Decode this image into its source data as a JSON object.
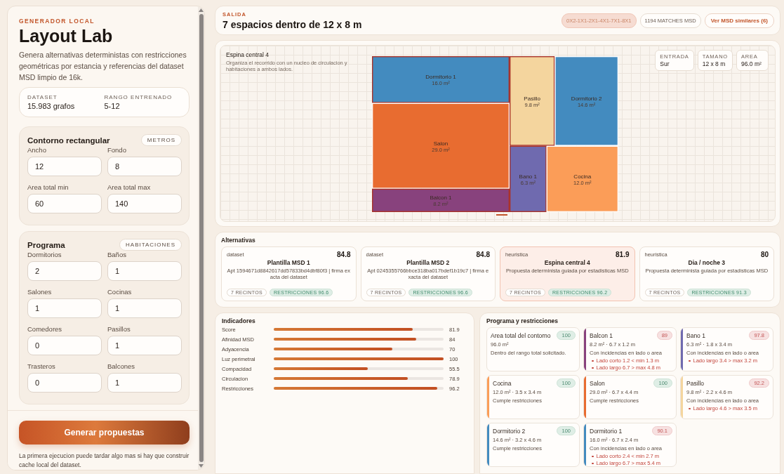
{
  "sidebar": {
    "kicker": "GENERADOR LOCAL",
    "title": "Layout Lab",
    "description": "Genera alternativas deterministas con restricciones geométricas por estancia y referencias del dataset MSD limpio de 16k.",
    "stats": [
      {
        "label": "DATASET",
        "value": "15.983 grafos"
      },
      {
        "label": "RANGO ENTRENADO",
        "value": "5-12"
      }
    ],
    "sections": [
      {
        "title": "Contorno rectangular",
        "tag": "METROS",
        "fields": [
          {
            "label": "Ancho",
            "value": "12"
          },
          {
            "label": "Fondo",
            "value": "8"
          },
          {
            "label": "Area total min",
            "value": "60"
          },
          {
            "label": "Area total max",
            "value": "140"
          }
        ]
      },
      {
        "title": "Programa",
        "tag": "HABITACIONES",
        "fields": [
          {
            "label": "Dormitorios",
            "value": "2"
          },
          {
            "label": "Baños",
            "value": "1"
          },
          {
            "label": "Salones",
            "value": "1"
          },
          {
            "label": "Cocinas",
            "value": "1"
          },
          {
            "label": "Comedores",
            "value": "0"
          },
          {
            "label": "Pasillos",
            "value": "1"
          },
          {
            "label": "Trasteros",
            "value": "0"
          },
          {
            "label": "Balcones",
            "value": "1"
          }
        ]
      }
    ],
    "button": "Generar propuestas",
    "note": "La primera ejecucion puede tardar algo mas si hay que construir cache local del dataset."
  },
  "output": {
    "kicker": "SALIDA",
    "title": "7 espacios dentro de 12 x 8 m",
    "signature": "0X2-1X1-2X1-4X1-7X1-8X1",
    "matches": "1194 MATCHES MSD",
    "link": "Ver MSD similares (6)"
  },
  "plan": {
    "title": "Espina central 4",
    "subtitle": "Organiza el recorrido con un nucleo de circulacion y habitaciones a ambos lados.",
    "chips": [
      {
        "label": "ENTRADA",
        "value": "Sur"
      },
      {
        "label": "TAMANO",
        "value": "12 x 8 m"
      },
      {
        "label": "AREA",
        "value": "96.0 m²"
      }
    ],
    "rooms": [
      {
        "name": "Dormitorio 1",
        "area": "16.0 m²",
        "color": "#438bbf",
        "issue": true
      },
      {
        "name": "Salon",
        "area": "29.0 m²",
        "color": "#e86c30",
        "issue": false
      },
      {
        "name": "Balcon 1",
        "area": "8.2 m²",
        "color": "#88427d",
        "issue": true
      },
      {
        "name": "Pasillo",
        "area": "9.8 m²",
        "color": "#f4d59e",
        "issue": true
      },
      {
        "name": "Dormitorio 2",
        "area": "14.6 m²",
        "color": "#438bbf",
        "issue": false
      },
      {
        "name": "Bano 1",
        "area": "6.3 m²",
        "color": "#6f6aaf",
        "issue": true
      },
      {
        "name": "Cocina",
        "area": "12.0 m²",
        "color": "#fb9d58",
        "issue": false
      }
    ]
  },
  "alternatives": {
    "title": "Alternativas",
    "items": [
      {
        "source": "dataset",
        "score": "84.8",
        "name": "Plantilla MSD 1",
        "description": "Apt 1594671d8842617dd57833bd4dbf80f3 | firma exacta del dataset",
        "rooms": "7 RECINTOS",
        "restrictions": "RESTRICCIONES 96.6",
        "selected": false
      },
      {
        "source": "dataset",
        "score": "84.8",
        "name": "Plantilla MSD 2",
        "description": "Apt 0245355766bbce318ba017bdef1b19c7 | firma exacta del dataset",
        "rooms": "7 RECINTOS",
        "restrictions": "RESTRICCIONES 96.6",
        "selected": false
      },
      {
        "source": "heuristica",
        "score": "81.9",
        "name": "Espina central 4",
        "description": "Propuesta determinista guiada por estadisticas MSD",
        "rooms": "7 RECINTOS",
        "restrictions": "RESTRICCIONES 96.2",
        "selected": true
      },
      {
        "source": "heuristica",
        "score": "80",
        "name": "Dia / noche 3",
        "description": "Propuesta determinista guiada por estadisticas MSD",
        "rooms": "7 RECINTOS",
        "restrictions": "RESTRICCIONES 91.3",
        "selected": false
      }
    ]
  },
  "indicators": {
    "title": "Indicadores",
    "items": [
      {
        "label": "Score",
        "level": 0.819,
        "value": "81.9"
      },
      {
        "label": "Afinidad MSD",
        "level": 0.84,
        "value": "84"
      },
      {
        "label": "Adyacencia",
        "level": 0.7,
        "value": "70"
      },
      {
        "label": "Luz perimetral",
        "level": 1,
        "value": "100"
      },
      {
        "label": "Compacidad",
        "level": 0.555,
        "value": "55.5"
      },
      {
        "label": "Circulacion",
        "level": 0.789,
        "value": "78.9"
      },
      {
        "label": "Restricciones",
        "level": 0.962,
        "value": "96.2"
      }
    ]
  },
  "constraints": {
    "title": "Programa y restricciones",
    "items": [
      {
        "name": "Area total del contorno",
        "score": "100",
        "ok": true,
        "detail": "96.0 m²",
        "status": "Dentro del rango total solicitado."
      },
      {
        "name": "Balcon 1",
        "score": "89",
        "ok": false,
        "color": "#88427d",
        "detail": "8.2 m² · 6.7 x 1.2 m",
        "status": "Con incidencias en lado o area",
        "issues": [
          "Lado corto 1.2 < min 1.3 m",
          "Lado largo 6.7 > max 4.8 m"
        ]
      },
      {
        "name": "Bano 1",
        "score": "97.8",
        "ok": false,
        "color": "#6f6aaf",
        "detail": "6.3 m² · 1.8 x 3.4 m",
        "status": "Con incidencias en lado o area",
        "issues": [
          "Lado largo 3.4 > max 3.2 m"
        ]
      },
      {
        "name": "Cocina",
        "score": "100",
        "ok": true,
        "color": "#fb9d58",
        "detail": "12.0 m² · 3.5 x 3.4 m",
        "status": "Cumple restricciones"
      },
      {
        "name": "Salon",
        "score": "100",
        "ok": true,
        "color": "#e86c30",
        "detail": "29.0 m² · 6.7 x 4.4 m",
        "status": "Cumple restricciones"
      },
      {
        "name": "Pasillo",
        "score": "92.2",
        "ok": false,
        "color": "#f4d59e",
        "detail": "9.8 m² · 2.2 x 4.6 m",
        "status": "Con incidencias en lado o area",
        "issues": [
          "Lado largo 4.6 > max 3.5 m"
        ]
      },
      {
        "name": "Dormitorio 2",
        "score": "100",
        "ok": true,
        "color": "#438bbf",
        "detail": "14.6 m² · 3.2 x 4.6 m",
        "status": "Cumple restricciones"
      },
      {
        "name": "Dormitorio 1",
        "score": "90.1",
        "ok": false,
        "color": "#438bbf",
        "detail": "16.0 m² · 6.7 x 2.4 m",
        "status": "Con incidencias en lado o area",
        "issues": [
          "Lado corto 2.4 < min 2.7 m",
          "Lado largo 6.7 > max 5.4 m"
        ]
      }
    ]
  }
}
